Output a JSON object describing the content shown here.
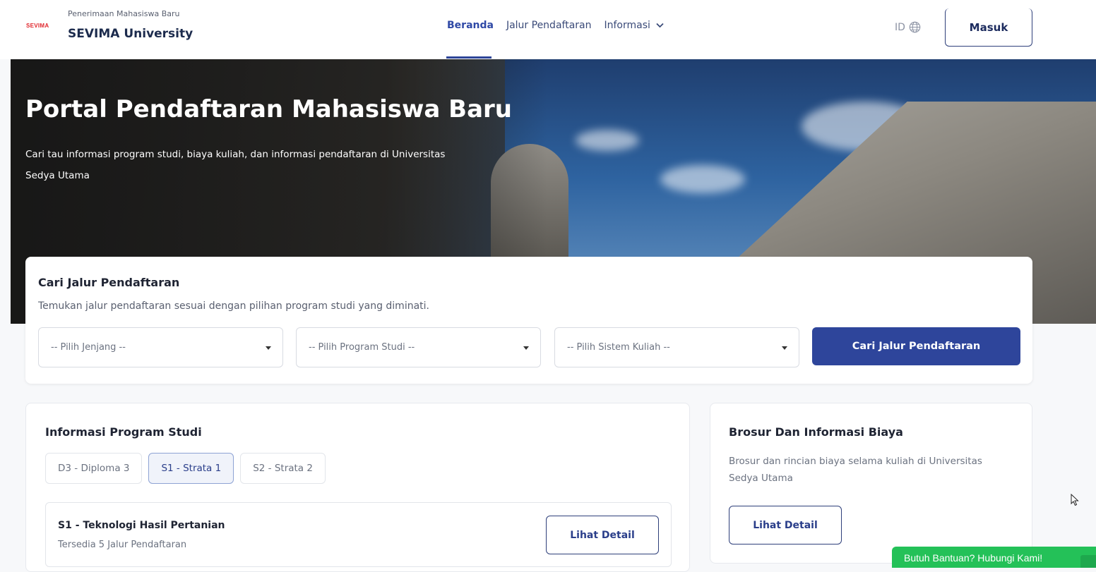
{
  "header": {
    "logo_text": "SEVIMA",
    "brand_subtitle": "Penerimaan Mahasiswa Baru",
    "brand_title": "SEVIMA University",
    "nav": [
      {
        "label": "Beranda",
        "active": true
      },
      {
        "label": "Jalur Pendaftaran",
        "active": false
      },
      {
        "label": "Informasi",
        "active": false,
        "has_dropdown": true
      }
    ],
    "language": "ID",
    "language_icon": "globe-icon",
    "login_label": "Masuk"
  },
  "hero": {
    "title": "Portal Pendaftaran Mahasiswa Baru",
    "description": "Cari tau informasi program studi, biaya kuliah, dan informasi pendaftaran di Universitas Sedya Utama"
  },
  "search": {
    "title": "Cari Jalur Pendaftaran",
    "subtitle": "Temukan jalur pendaftaran sesuai dengan pilihan program studi yang diminati.",
    "selects": [
      {
        "placeholder": "-- Pilih Jenjang --"
      },
      {
        "placeholder": "-- Pilih Program Studi --"
      },
      {
        "placeholder": "-- Pilih Sistem Kuliah --"
      }
    ],
    "button_label": "Cari Jalur Pendaftaran"
  },
  "program": {
    "title": "Informasi Program Studi",
    "tabs": [
      {
        "label": "D3 - Diploma 3",
        "active": false
      },
      {
        "label": "S1 - Strata 1",
        "active": true
      },
      {
        "label": "S2 - Strata 2",
        "active": false
      }
    ],
    "items": [
      {
        "name": "S1 - Teknologi Hasil Pertanian",
        "count": "Tersedia 5 Jalur Pendaftaran",
        "button_label": "Lihat Detail"
      }
    ]
  },
  "brochure": {
    "title": "Brosur Dan Informasi Biaya",
    "description": "Brosur dan rincian biaya selama kuliah di Universitas Sedya Utama",
    "button_label": "Lihat Detail"
  },
  "help": {
    "label": "Butuh Bantuan? Hubungi Kami!",
    "icon": "whatsapp-icon"
  },
  "colors": {
    "primary": "#2e459b",
    "help_green": "#24c158",
    "logo_red": "#e0262c"
  }
}
